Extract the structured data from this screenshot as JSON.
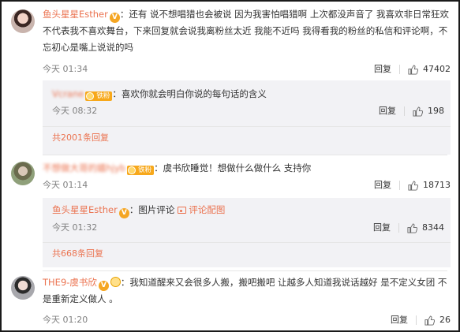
{
  "comments": [
    {
      "user": "鱼头星星Esther",
      "text": "还有 说不想唱猎也会被说  因为我害怕唱猎啊 上次都没声音了 我喜欢非日常狂欢  不代表我不喜欢舞台，下来回复就会说我离粉丝太近 我能不近吗 我得看我的粉丝的私信和评论啊，不忘初心是嘴上说说的吗",
      "time": "今天 01:34",
      "reply_label": "回复",
      "likes": "47402",
      "sub_reply": {
        "user": "Vcrane",
        "fan_label": "铁粉",
        "text": "喜欢你就会明白你说的每句话的含义",
        "time": "今天 08:32",
        "reply_label": "回复",
        "likes": "198"
      },
      "more_replies": "共2001条回复"
    },
    {
      "user": "不想做大哥的嬉hjyb",
      "fan_label": "铁粉",
      "text": "虞书欣睡觉！想做什么做什么 支持你",
      "time": "今天 01:14",
      "reply_label": "回复",
      "likes": "18713",
      "sub_reply": {
        "user": "鱼头星星Esther",
        "text": "图片评论",
        "link_text": "评论配图",
        "time": "今天 01:32",
        "reply_label": "回复",
        "likes": "8344"
      },
      "more_replies": "共668条回复"
    },
    {
      "user": "THE9-虞书欣",
      "text": "我知道醒来又会很多人搬，搬吧搬吧  让越多人知道我说话越好   是不定义女团 不是重新定义做人 。",
      "time": "今天 01:20",
      "reply_label": "回复",
      "likes": "26"
    }
  ],
  "colors": {
    "name": "#eb7350",
    "meta": "#808080",
    "sub_bg": "#f2f2f5"
  }
}
